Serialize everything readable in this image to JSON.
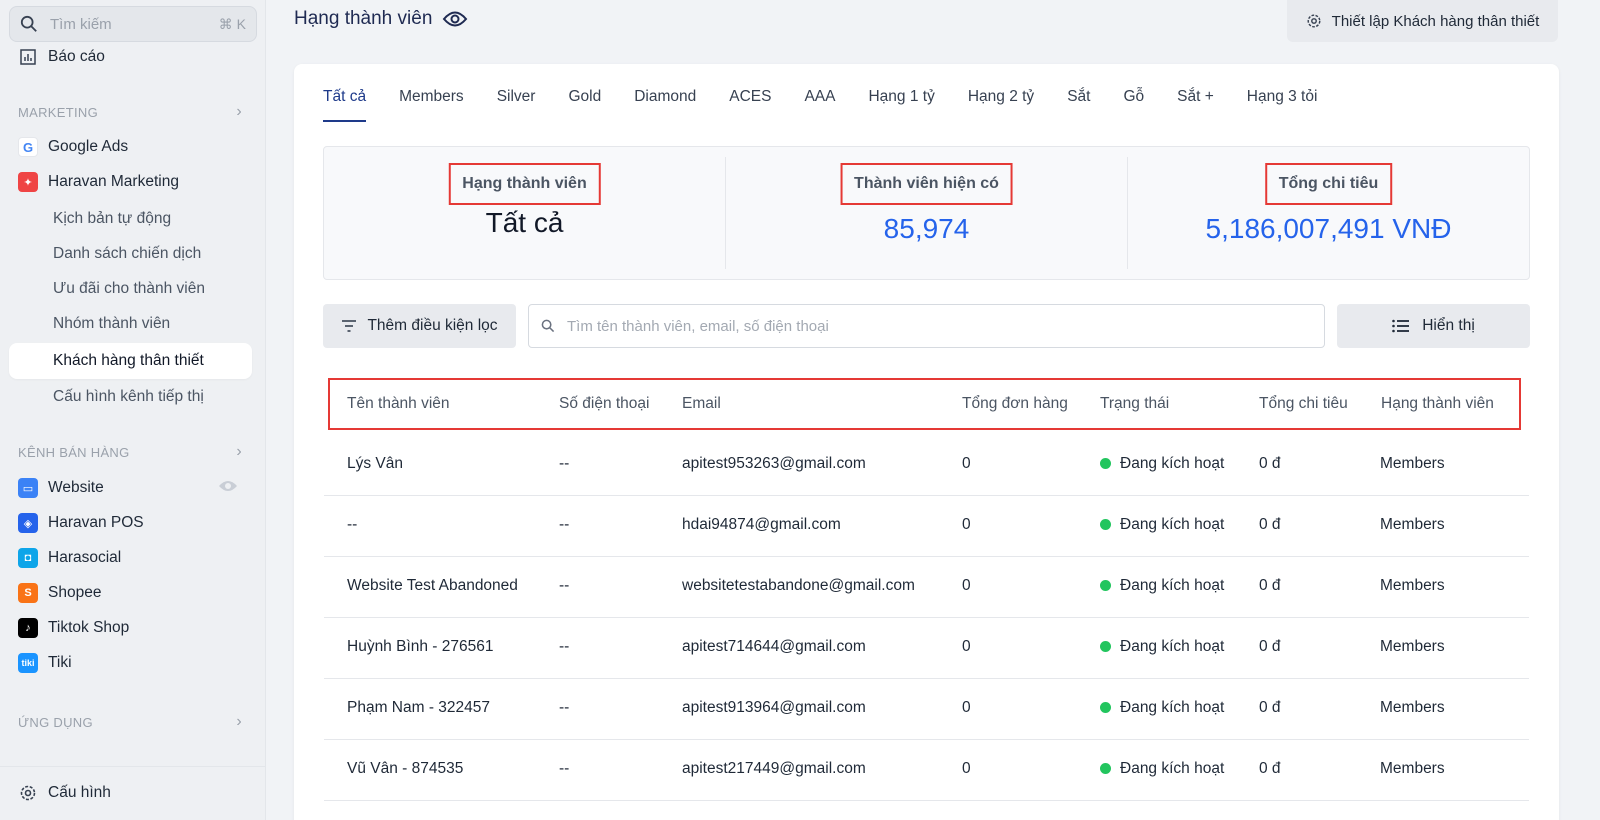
{
  "sidebar": {
    "search_placeholder": "Tìm kiếm",
    "search_shortcut": "⌘ K",
    "report": "Báo cáo",
    "marketing_title": "MARKETING",
    "google_ads": "Google Ads",
    "haravan_marketing": "Haravan Marketing",
    "sub_items": [
      "Kịch bản tự động",
      "Danh sách chiến dịch",
      "Ưu đãi cho thành viên",
      "Nhóm thành viên",
      "Khách hàng thân thiết",
      "Cấu hình kênh tiếp thị"
    ],
    "sales_title": "KÊNH BÁN HÀNG",
    "channels": [
      "Website",
      "Haravan POS",
      "Harasocial",
      "Shopee",
      "Tiktok Shop",
      "Tiki"
    ],
    "apps_title": "ỨNG DỤNG",
    "settings": "Cấu hình"
  },
  "header": {
    "title": "Hạng thành viên",
    "loyalty_button": "Thiết lập Khách hàng thân thiết"
  },
  "tabs": [
    "Tất cả",
    "Members",
    "Silver",
    "Gold",
    "Diamond",
    "ACES",
    "AAA",
    "Hạng 1 tỷ",
    "Hạng 2 tỷ",
    "Sắt",
    "Gỗ",
    "Sắt +",
    "Hạng 3 tỏi"
  ],
  "stats": {
    "rank_label": "Hạng thành viên",
    "rank_value": "Tất cả",
    "members_label": "Thành viên hiện có",
    "members_value": "85,974",
    "spend_label": "Tổng chi tiêu",
    "spend_value": "5,186,007,491 VNĐ"
  },
  "toolbar": {
    "filter_button": "Thêm điều kiện lọc",
    "search_placeholder": "Tìm tên thành viên, email, số điện thoại",
    "display_button": "Hiển thị"
  },
  "table": {
    "columns": [
      "Tên thành viên",
      "Số điện thoại",
      "Email",
      "Tổng đơn hàng",
      "Trạng thái",
      "Tổng chi tiêu",
      "Hạng thành viên"
    ],
    "rows": [
      [
        "Lýs Vân",
        "--",
        "apitest953263@gmail.com",
        "0",
        "Đang kích hoạt",
        "0 đ",
        "Members"
      ],
      [
        "--",
        "--",
        "hdai94874@gmail.com",
        "0",
        "Đang kích hoạt",
        "0 đ",
        "Members"
      ],
      [
        "Website Test Abandoned",
        "--",
        "websitetestabandone@gmail.com",
        "0",
        "Đang kích hoạt",
        "0 đ",
        "Members"
      ],
      [
        "Huỳnh Bình - 276561",
        "--",
        "apitest714644@gmail.com",
        "0",
        "Đang kích hoạt",
        "0 đ",
        "Members"
      ],
      [
        "Phạm Nam - 322457",
        "--",
        "apitest913964@gmail.com",
        "0",
        "Đang kích hoạt",
        "0 đ",
        "Members"
      ],
      [
        "Vũ Vân - 874535",
        "--",
        "apitest217449@gmail.com",
        "0",
        "Đang kích hoạt",
        "0 đ",
        "Members"
      ]
    ]
  },
  "colors": {
    "accent": "#2563eb",
    "active_status": "#22c55e",
    "highlight_box": "#e53935"
  }
}
